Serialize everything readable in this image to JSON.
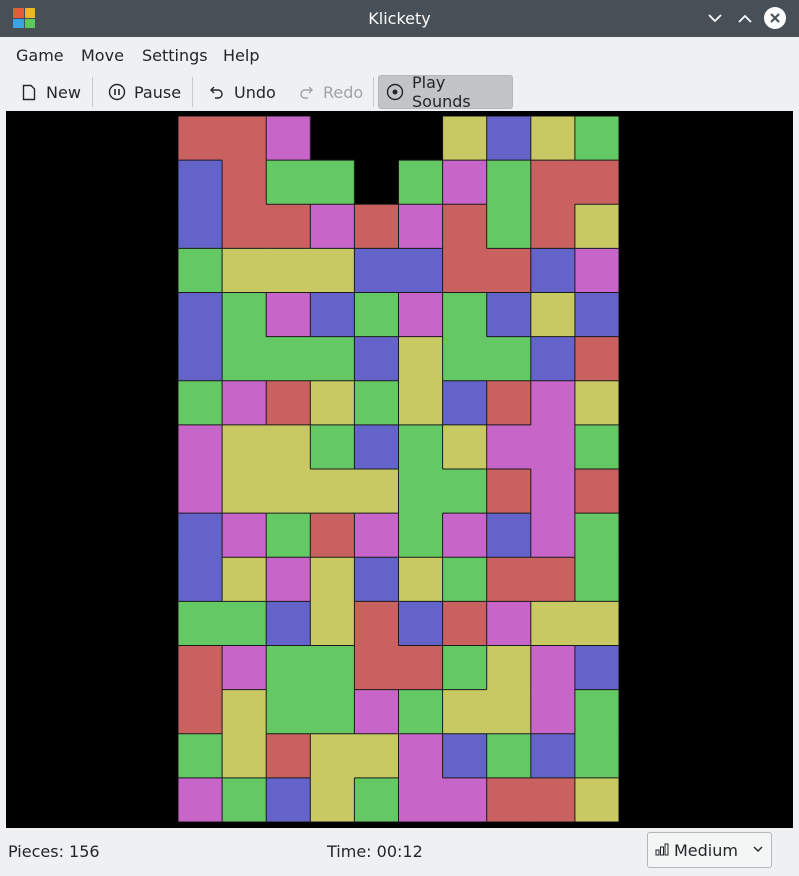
{
  "window": {
    "title": "Klickety"
  },
  "menu": [
    "Game",
    "Move",
    "Settings",
    "Help"
  ],
  "toolbar": {
    "new_label": "New",
    "pause_label": "Pause",
    "undo_label": "Undo",
    "redo_label": "Redo",
    "sounds_label": "Play Sounds"
  },
  "status": {
    "pieces": "Pieces: 156",
    "time": "Time: 00:12",
    "difficulty": "Medium"
  },
  "colors": {
    "R": "#c96160",
    "P": "#c865c9",
    "B": "#6363c9",
    "Y": "#c9c964",
    "G": "#64c964",
    ".": "#000000"
  },
  "board": [
    "RRP...YBYG",
    "BRGG.GPGRR",
    "BRRPRPRGRY",
    "GYYYBBRRBP",
    "BGPBGPGBYB",
    "BGGGBYGGBR",
    "GPRYGYBRPY",
    "PYYGBGYPPG",
    "PYYYYGGRPR",
    "BPGRPGPBPG",
    "BYPYBYGRRG",
    "GGBYRBRPYY",
    "RPGGRRGYPB",
    "RYGGPGYYPG",
    "GYRYYPBGBG",
    "PGBYGPPRRY"
  ]
}
